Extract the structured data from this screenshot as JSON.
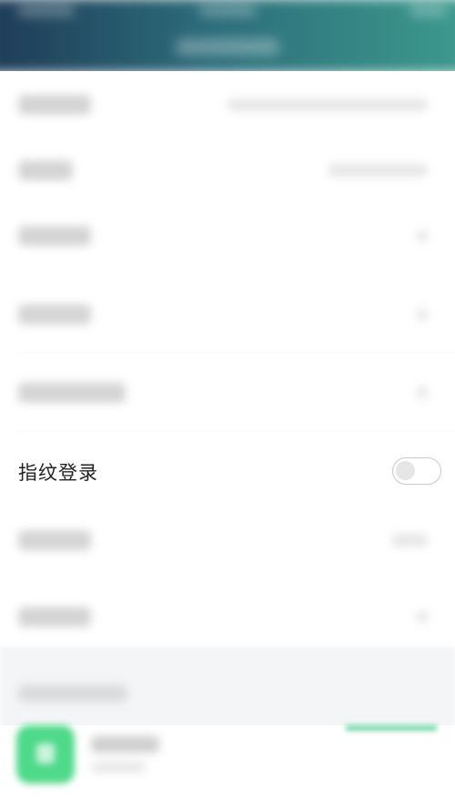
{
  "settings": {
    "fingerprint_login": {
      "label": "指纹登录",
      "enabled": false
    }
  },
  "colors": {
    "header_start": "#1f3b57",
    "header_end": "#3d9a8d",
    "toggle_border": "#c9c9c9",
    "toggle_knob": "#e6e6e6",
    "app_icon": "#4fd98a",
    "section_gray": "#f4f5f7"
  },
  "icons": {
    "app_icon": "phone-icon"
  }
}
